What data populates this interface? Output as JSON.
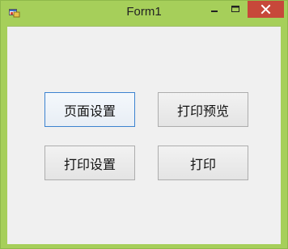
{
  "window": {
    "title": "Form1",
    "frame_color": "#a6cf5a",
    "close_button_color": "#c7483a"
  },
  "titlebar": {
    "app_icon": "winforms-app-icon",
    "minimize_icon": "minimize-icon",
    "maximize_icon": "maximize-icon",
    "close_icon": "close-icon"
  },
  "buttons": {
    "page_setup": "页面设置",
    "print_preview": "打印预览",
    "print_setup": "打印设置",
    "print": "打印"
  }
}
